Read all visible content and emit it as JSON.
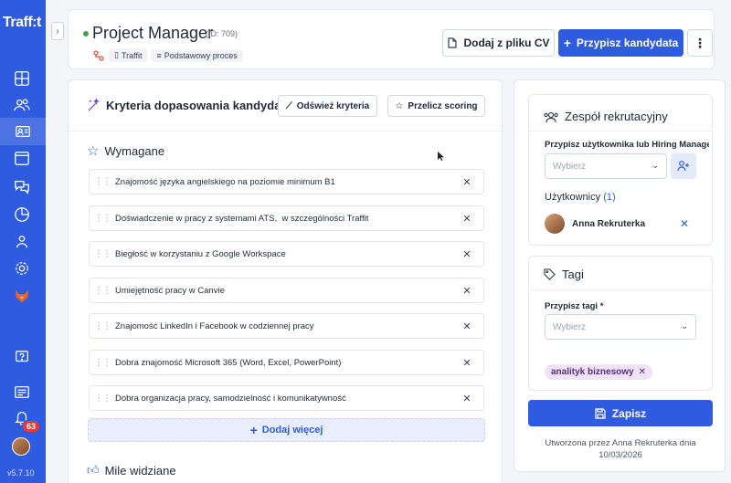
{
  "app": {
    "logo": "Traff:t",
    "version": "v5.7.10",
    "notifications_count": "63"
  },
  "header": {
    "title": "Project Manager",
    "id_label": "(ID: 709)",
    "chips": [
      "Traffit",
      "Podstawowy proces"
    ],
    "add_cv_label": "Dodaj z pliku CV",
    "assign_candidate_label": "Przypisz kandydata",
    "more_label": "⋮"
  },
  "criteria": {
    "title": "Kryteria dopasowania kandydata",
    "refresh_label": "Odśwież kryteria",
    "scoring_label": "Przelicz scoring",
    "required_title": "Wymagane",
    "items": [
      "Znajomość języka angielskiego na poziomie minimum B1",
      "Doświadczenie w pracy z systemami ATS,  w szczególności Traffit",
      "Biegłość w korzystaniu z Google Workspace",
      "Umiejętność pracy w Canvie",
      "Znajomość LinkedIn i Facebook w codziennej pracy",
      "Dobra znajomość Microsoft 365 (Word, Excel, PowerPoint)",
      "Dobra organizacja pracy, samodzielność i komunikatywność"
    ],
    "add_more_label": "Dodaj więcej",
    "nice_to_have_title": "Mile widziane"
  },
  "team": {
    "title": "Zespół rekrutacyjny",
    "assign_label": "Przypisz użytkownika lub Hiring Manage…",
    "select_placeholder": "Wybierz",
    "users_label": "Użytkownicy",
    "users_count": "(1)",
    "user_name": "Anna Rekruterka"
  },
  "tags": {
    "title": "Tagi",
    "assign_label": "Przypisz tagi *",
    "select_placeholder": "Wybierz",
    "tag": "analityk biznesowy"
  },
  "footer": {
    "save_label": "Zapisz",
    "created_line1": "Utworzona przez Anna Rekruterka dnia",
    "created_line2": "10/03/2026"
  },
  "colors": {
    "primary": "#2f5be0",
    "sidebar": "#2f5be0",
    "tag_bg": "#efe3f7",
    "status_green": "#43a047"
  }
}
